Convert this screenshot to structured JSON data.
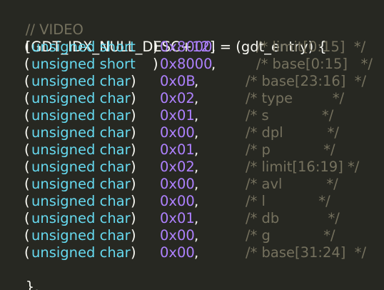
{
  "editor": {
    "lines": {
      "comment_header": "// VIDEO",
      "entry_open_prefix": "[GDT_IDX_NULL_DESC+",
      "entry_open_number": "12",
      "entry_open_suffix": "] = (gdt_entry) {",
      "fields": [
        {
          "type": "unsigned short",
          "value": "0x8000",
          "comment": "/* limit[0:15]  */"
        },
        {
          "type": "unsigned short",
          "value": "0x8000",
          "comment": "/* base[0:15]   */"
        },
        {
          "type": "unsigned char",
          "value": "0x0B",
          "comment": "/* base[23:16]  */"
        },
        {
          "type": "unsigned char",
          "value": "0x02",
          "comment": "/* type         */"
        },
        {
          "type": "unsigned char",
          "value": "0x01",
          "comment": "/* s            */"
        },
        {
          "type": "unsigned char",
          "value": "0x00",
          "comment": "/* dpl          */"
        },
        {
          "type": "unsigned char",
          "value": "0x01",
          "comment": "/* p            */"
        },
        {
          "type": "unsigned char",
          "value": "0x02",
          "comment": "/* limit[16:19] */"
        },
        {
          "type": "unsigned char",
          "value": "0x00",
          "comment": "/* avl          */"
        },
        {
          "type": "unsigned char",
          "value": "0x00",
          "comment": "/* l            */"
        },
        {
          "type": "unsigned char",
          "value": "0x01",
          "comment": "/* db           */"
        },
        {
          "type": "unsigned char",
          "value": "0x00",
          "comment": "/* g            */"
        },
        {
          "type": "unsigned char",
          "value": "0x00",
          "comment": "/* base[31:24]  */"
        }
      ],
      "entry_close": "},"
    },
    "syntax": {
      "open_paren": "(",
      "close_paren": ")",
      "comma": ","
    },
    "colors": {
      "background": "#272822",
      "plain": "#f8f8f2",
      "comment": "#75715e",
      "number": "#ae81ff",
      "type": "#66d9ef"
    }
  }
}
